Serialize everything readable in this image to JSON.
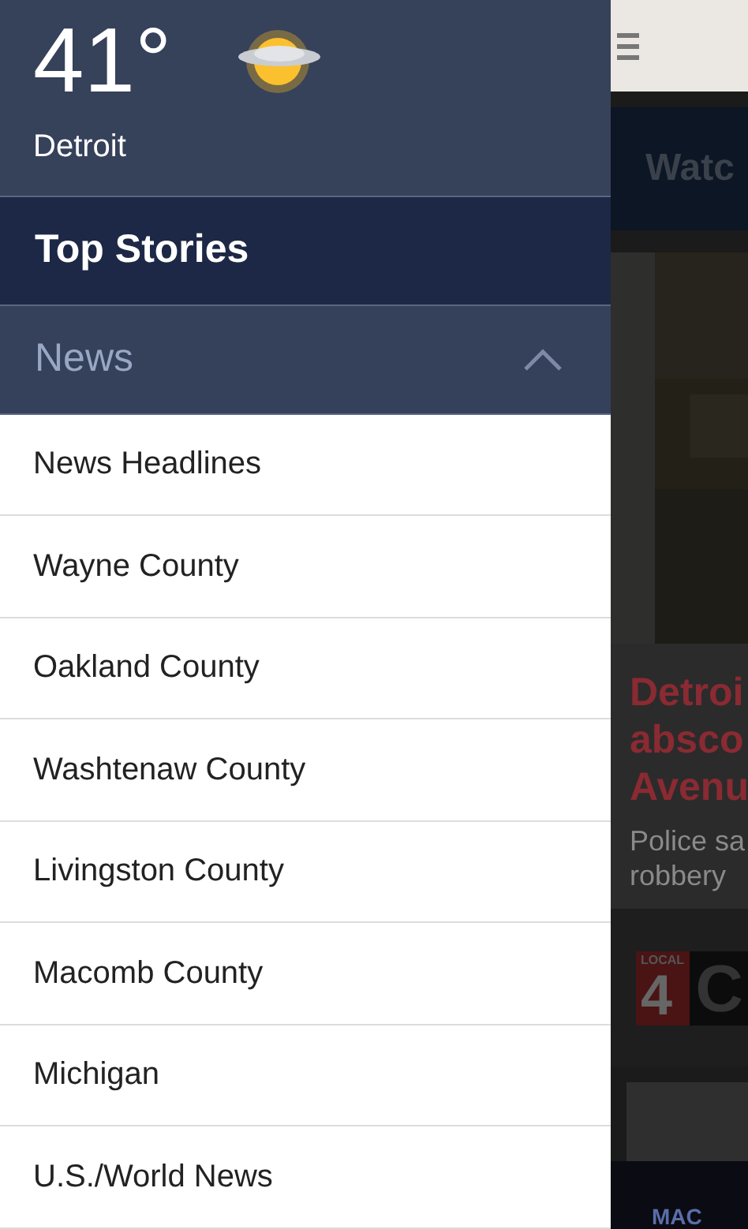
{
  "weather": {
    "temperature": "41°",
    "city": "Detroit"
  },
  "menu": [
    {
      "label": "Top Stories",
      "selected": true
    },
    {
      "label": "News",
      "selected": false,
      "expanded": true,
      "children": [
        {
          "label": "News Headlines"
        },
        {
          "label": "Wayne County"
        },
        {
          "label": "Oakland County"
        },
        {
          "label": "Washtenaw County"
        },
        {
          "label": "Livingston County"
        },
        {
          "label": "Macomb County"
        },
        {
          "label": "Michigan"
        },
        {
          "label": "U.S./World News"
        }
      ]
    }
  ],
  "background_page": {
    "tab": "Watc",
    "headline": [
      "Detroi",
      "absco",
      "Avenu"
    ],
    "summary": [
      "Police sa",
      "robbery"
    ],
    "logo": {
      "badge": "LOCAL",
      "number": "4",
      "letter": "C"
    },
    "footer": "MAC"
  }
}
